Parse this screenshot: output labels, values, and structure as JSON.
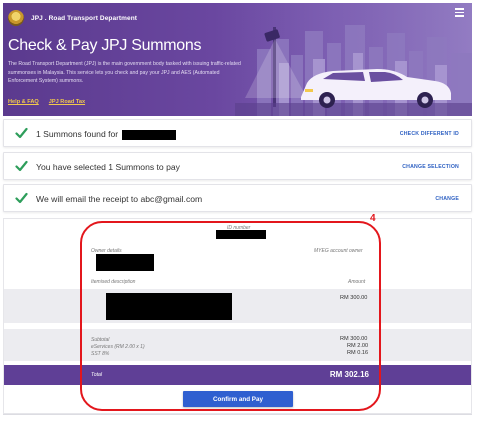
{
  "header": {
    "department": "JPJ . Road Transport Department",
    "title": "Check & Pay JPJ Summons",
    "description": "The Road Transport Department (JPJ) is the main government body tasked with issuing traffic-related summonses in Malaysia. This service lets you check and pay your JPJ and AES (Automated Enforcement System) summons.",
    "links": [
      "Help & FAQ",
      "JPJ Road Tax"
    ]
  },
  "steps": [
    {
      "message": "1 Summons found for",
      "action": "CHECK DIFFERENT ID"
    },
    {
      "message": "You have selected 1 Summons to pay",
      "action": "CHANGE SELECTION"
    },
    {
      "message": "We will email the receipt to abc@gmail.com",
      "action": "CHANGE"
    }
  ],
  "summary": {
    "id_label": "ID number",
    "owner_label": "Owner details",
    "account_label": "MYEG account owner",
    "itemised_label": "Itemised description",
    "amount_label": "Amount",
    "item_amount": "RM 300.00",
    "subtotal_label": "Subtotal",
    "subtotal_value": "RM 300.00",
    "eservices_label": "eServices (RM 2.00 x 1)",
    "eservices_value": "RM 2.00",
    "sst_label": "SST 8%",
    "sst_value": "RM 0.16",
    "total_label": "Total",
    "total_value": "RM 302.16",
    "pay_button": "Confirm and Pay"
  },
  "annotation": {
    "number": "4",
    "color": "#e3161c"
  },
  "colors": {
    "brand_purple": "#5f3f96",
    "check_green": "#2e9e5b",
    "link_blue": "#2c5fc2",
    "button_blue": "#2f5fd0",
    "gold_link": "#f2c94c"
  },
  "icons": [
    "crest-logo",
    "menu-icon",
    "check-icon",
    "city-skyline-illustration",
    "car-illustration",
    "traffic-camera-illustration"
  ]
}
